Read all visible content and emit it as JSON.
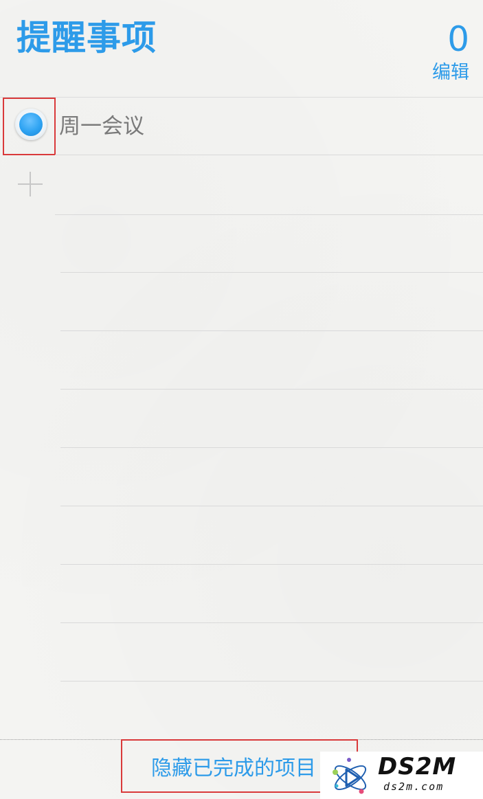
{
  "header": {
    "title": "提醒事项",
    "count": "0",
    "edit_label": "编辑"
  },
  "reminders": [
    {
      "text": "周一会议",
      "status": "selected"
    }
  ],
  "add_icon": "plus-icon",
  "footer": {
    "hide_completed_label": "隐藏已完成的项目"
  },
  "watermark": {
    "brand": "DS2M",
    "url": "ds2m.com"
  },
  "colors": {
    "accent": "#2d9be9",
    "annotation": "#d9393a",
    "item_text": "#7a7a7a"
  }
}
